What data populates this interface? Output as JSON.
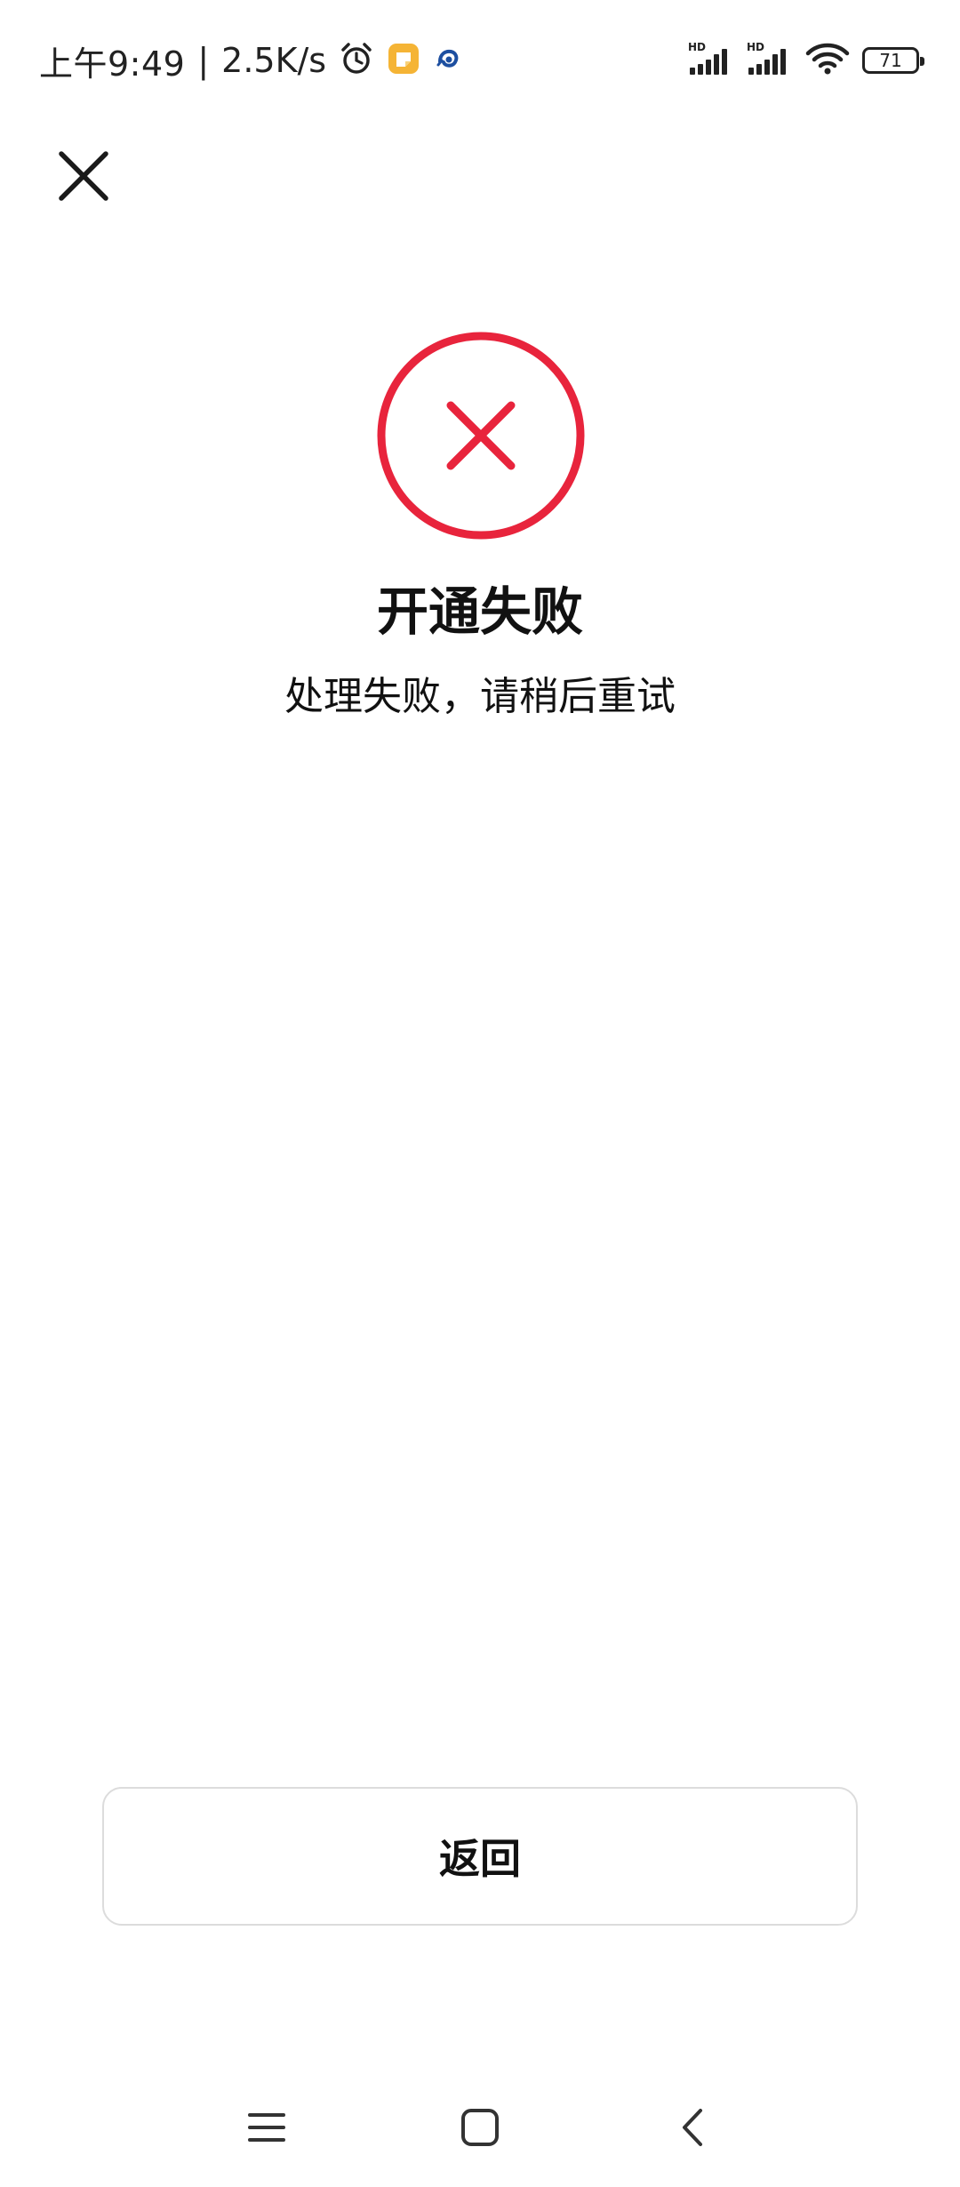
{
  "status_bar": {
    "time": "上午9:49",
    "separator": "|",
    "network_speed": "2.5K/s",
    "icons": [
      "alarm-icon",
      "notes-app-icon",
      "app-notification-icon"
    ],
    "signal_labels": [
      "HD",
      "HD"
    ],
    "battery_level": "71"
  },
  "header": {
    "close_icon": "close-icon"
  },
  "result": {
    "status": "failure",
    "icon": "error-circle-icon",
    "accent_color": "#e8243c",
    "title": "开通失败",
    "message": "处理失败，请稍后重试"
  },
  "actions": {
    "return_label": "返回"
  },
  "navigation_bar": {
    "icons": [
      "menu-icon",
      "home-icon",
      "back-icon"
    ]
  }
}
